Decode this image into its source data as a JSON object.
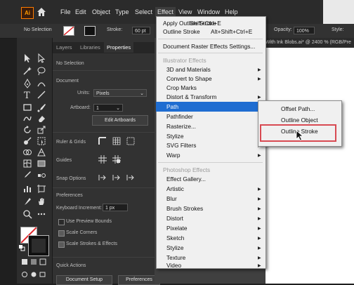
{
  "menubar": {
    "logo_text": "Ai",
    "items": [
      "File",
      "Edit",
      "Object",
      "Type",
      "Select",
      "Effect",
      "View",
      "Window",
      "Help"
    ]
  },
  "control_bar": {
    "selection": "No Selection",
    "stroke_label": "Stroke:",
    "stroke_value": "60 pt",
    "opacity_label": "Opacity:",
    "opacity_value": "100%",
    "style_label": "Style:"
  },
  "document_title": "With Ink Blobs.ai* @ 2400 % (RGB/Pre",
  "panel": {
    "tabs": [
      "Layers",
      "Libraries",
      "Properties"
    ],
    "no_selection": "No Selection",
    "document_header": "Document",
    "units_label": "Units:",
    "units_value": "Pixels",
    "artboard_label": "Artboard:",
    "artboard_value": "1",
    "edit_artboards": "Edit Artboards",
    "ruler_grids": "Ruler & Grids",
    "guides": "Guides",
    "snap_options": "Snap Options",
    "preferences_header": "Preferences",
    "keyboard_increment_label": "Keyboard Increment:",
    "keyboard_increment_value": "1 px",
    "use_preview_bounds": "Use Preview Bounds",
    "scale_corners": "Scale Corners",
    "scale_strokes": "Scale Strokes & Effects",
    "quick_actions": "Quick Actions",
    "document_setup": "Document Setup",
    "preferences_button": "Preferences"
  },
  "effect_menu": {
    "apply_outline_stroke": "Apply Outline Stroke",
    "apply_outline_stroke_shortcut": "Shift+Ctrl+E",
    "outline_stroke": "Outline Stroke",
    "outline_stroke_shortcut": "Alt+Shift+Ctrl+E",
    "document_raster_settings": "Document Raster Effects Settings...",
    "illustrator_effects_header": "Illustrator Effects",
    "illustrator_items": [
      "3D and Materials",
      "Convert to Shape",
      "Crop Marks",
      "Distort & Transform",
      "Path",
      "Pathfinder",
      "Rasterize...",
      "Stylize",
      "SVG Filters",
      "Warp"
    ],
    "photoshop_effects_header": "Photoshop Effects",
    "photoshop_items": [
      "Effect Gallery...",
      "Artistic",
      "Blur",
      "Brush Strokes",
      "Distort",
      "Pixelate",
      "Sketch",
      "Stylize",
      "Texture",
      "Video"
    ]
  },
  "path_submenu": {
    "items": [
      "Offset Path...",
      "Outline Object",
      "Outline Stroke"
    ]
  },
  "colors": {
    "highlight": "#1f6dd1",
    "annotation_box": "#d84a52",
    "menu_bg": "#f0f0f0"
  }
}
